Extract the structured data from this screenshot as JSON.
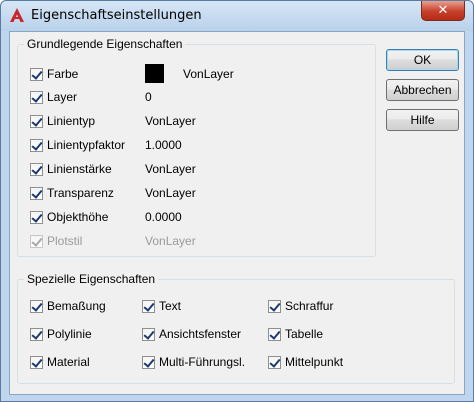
{
  "window": {
    "title": "Eigenschaftseinstellungen",
    "close_glyph": "✕"
  },
  "basic": {
    "group_label": "Grundlegende Eigenschaften",
    "color_value": "VonLayer",
    "swatch_color": "#000000",
    "items": [
      {
        "label": "Farbe",
        "value": "",
        "checked": true,
        "enabled": true
      },
      {
        "label": "Layer",
        "value": "0",
        "checked": true,
        "enabled": true
      },
      {
        "label": "Linientyp",
        "value": "VonLayer",
        "checked": true,
        "enabled": true
      },
      {
        "label": "Linientypfaktor",
        "value": "1.0000",
        "checked": true,
        "enabled": true
      },
      {
        "label": "Linienstärke",
        "value": "VonLayer",
        "checked": true,
        "enabled": true
      },
      {
        "label": "Transparenz",
        "value": "VonLayer",
        "checked": true,
        "enabled": true
      },
      {
        "label": "Objekthöhe",
        "value": "0.0000",
        "checked": true,
        "enabled": true
      },
      {
        "label": "Plotstil",
        "value": "VonLayer",
        "checked": true,
        "enabled": false
      }
    ]
  },
  "special": {
    "group_label": "Spezielle Eigenschaften",
    "items": [
      {
        "label": "Bemaßung",
        "checked": true
      },
      {
        "label": "Text",
        "checked": true
      },
      {
        "label": "Schraffur",
        "checked": true
      },
      {
        "label": "Polylinie",
        "checked": true
      },
      {
        "label": "Ansichtsfenster",
        "checked": true
      },
      {
        "label": "Tabelle",
        "checked": true
      },
      {
        "label": "Material",
        "checked": true
      },
      {
        "label": "Multi-Führungsl.",
        "checked": true
      },
      {
        "label": "Mittelpunkt",
        "checked": true
      }
    ]
  },
  "buttons": {
    "ok": "OK",
    "cancel": "Abbrechen",
    "help": "Hilfe"
  }
}
